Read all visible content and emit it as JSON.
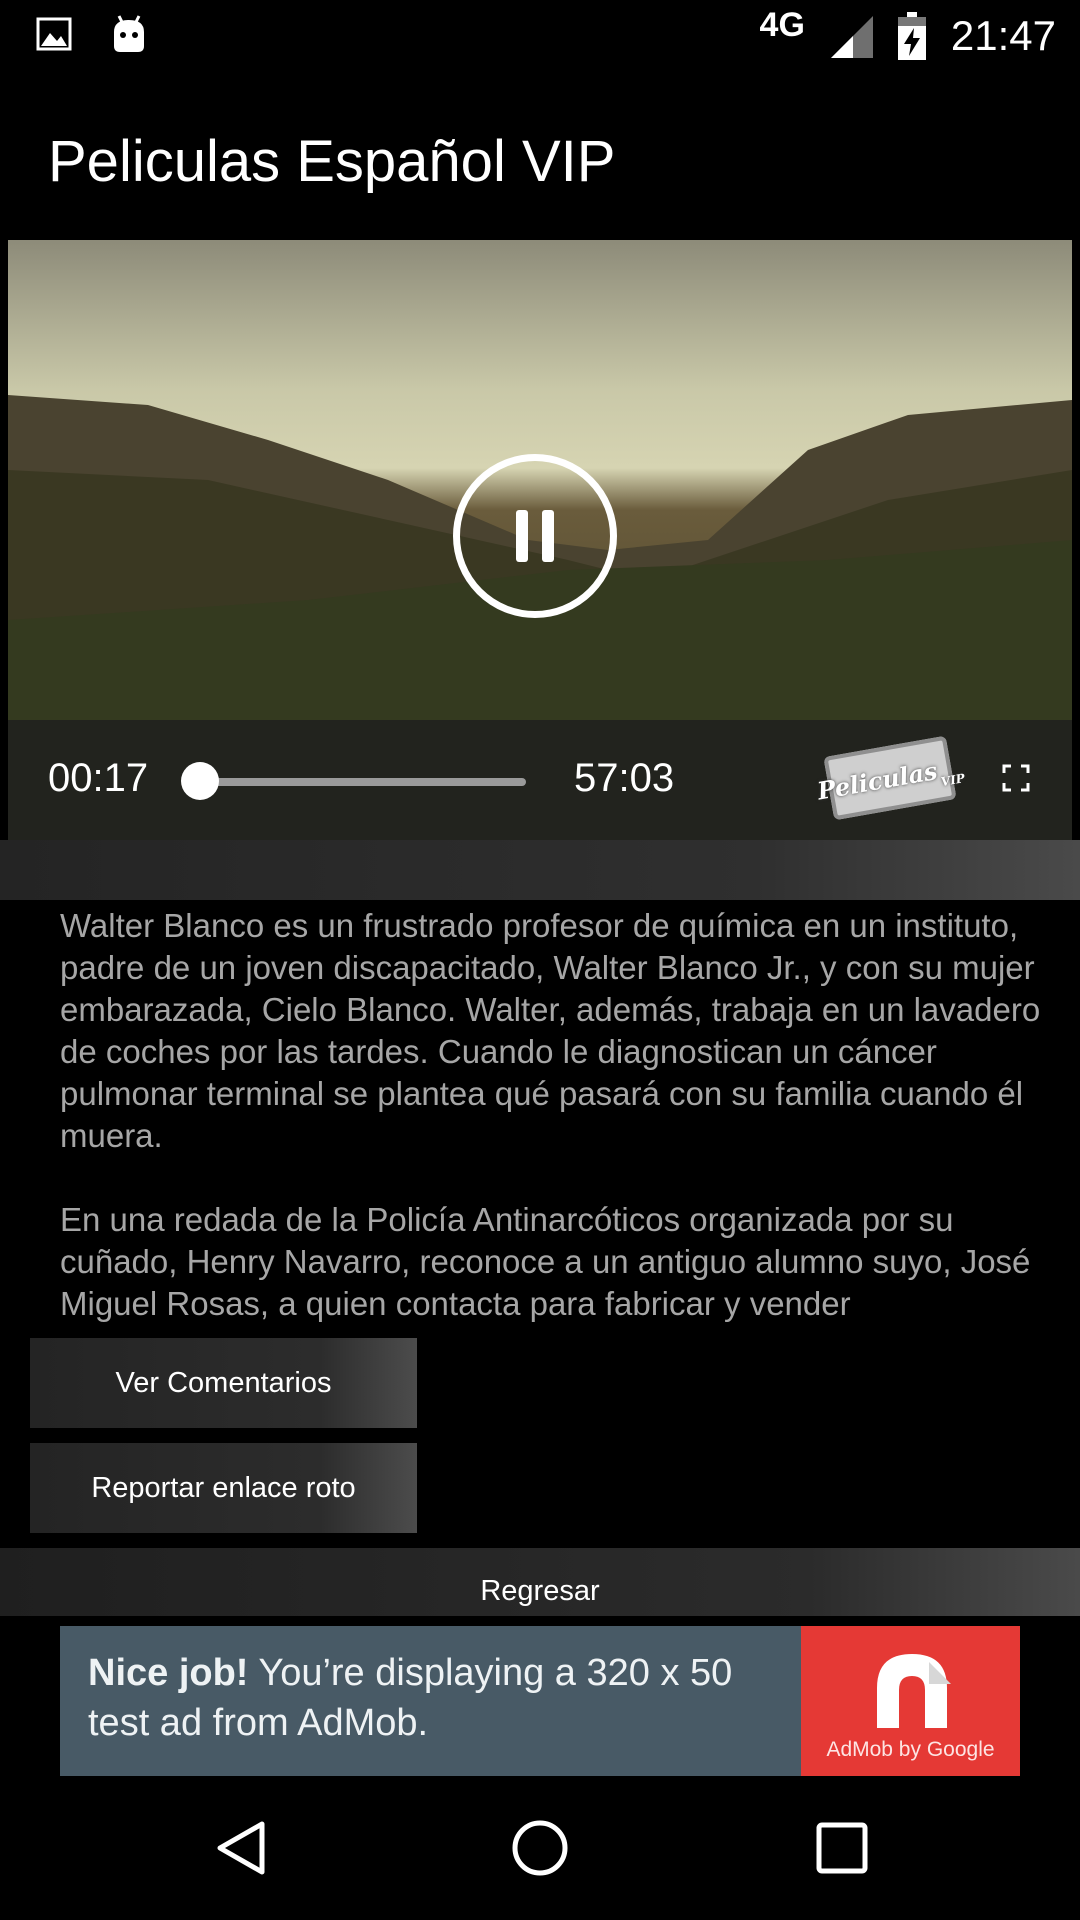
{
  "status_bar": {
    "network": "4G",
    "time": "21:47",
    "icons": [
      "image-notification-icon",
      "android-notification-icon",
      "signal-icon",
      "battery-charging-icon"
    ]
  },
  "app_bar": {
    "title": "Peliculas Español VIP"
  },
  "player": {
    "current_time": "00:17",
    "total_time": "57:03",
    "progress_fraction": 0.005,
    "state_icon": "pause-icon",
    "logo_text": "Peliculas",
    "logo_subtext": "VIP"
  },
  "description": {
    "paragraphs": [
      "Walter Blanco es un frustrado profesor de química en un instituto, padre de un joven discapacitado, Walter Blanco Jr., y con su mujer embarazada, Cielo Blanco. Walter, además, trabaja en un lavadero de coches por las tardes. Cuando le diagnostican un cáncer pulmonar terminal se plantea qué pasará con su familia cuando él muera.",
      "En una redada de la Policía Antinarcóticos organizada por su cuñado, Henry Navarro, reconoce a un antiguo alumno suyo, José Miguel Rosas, a quien contacta para fabricar y vender"
    ]
  },
  "buttons": {
    "comments": "Ver Comentarios",
    "report": "Reportar enlace roto",
    "back": "Regresar"
  },
  "ad": {
    "headline": "Nice job!",
    "body": " You’re displaying a 320 x 50 test ad from AdMob.",
    "brand": "AdMob by Google",
    "colors": {
      "background": "#485a66",
      "logo_background": "#e53935"
    }
  },
  "nav_bar": {
    "icons": [
      "back-icon",
      "home-icon",
      "recents-icon"
    ]
  }
}
